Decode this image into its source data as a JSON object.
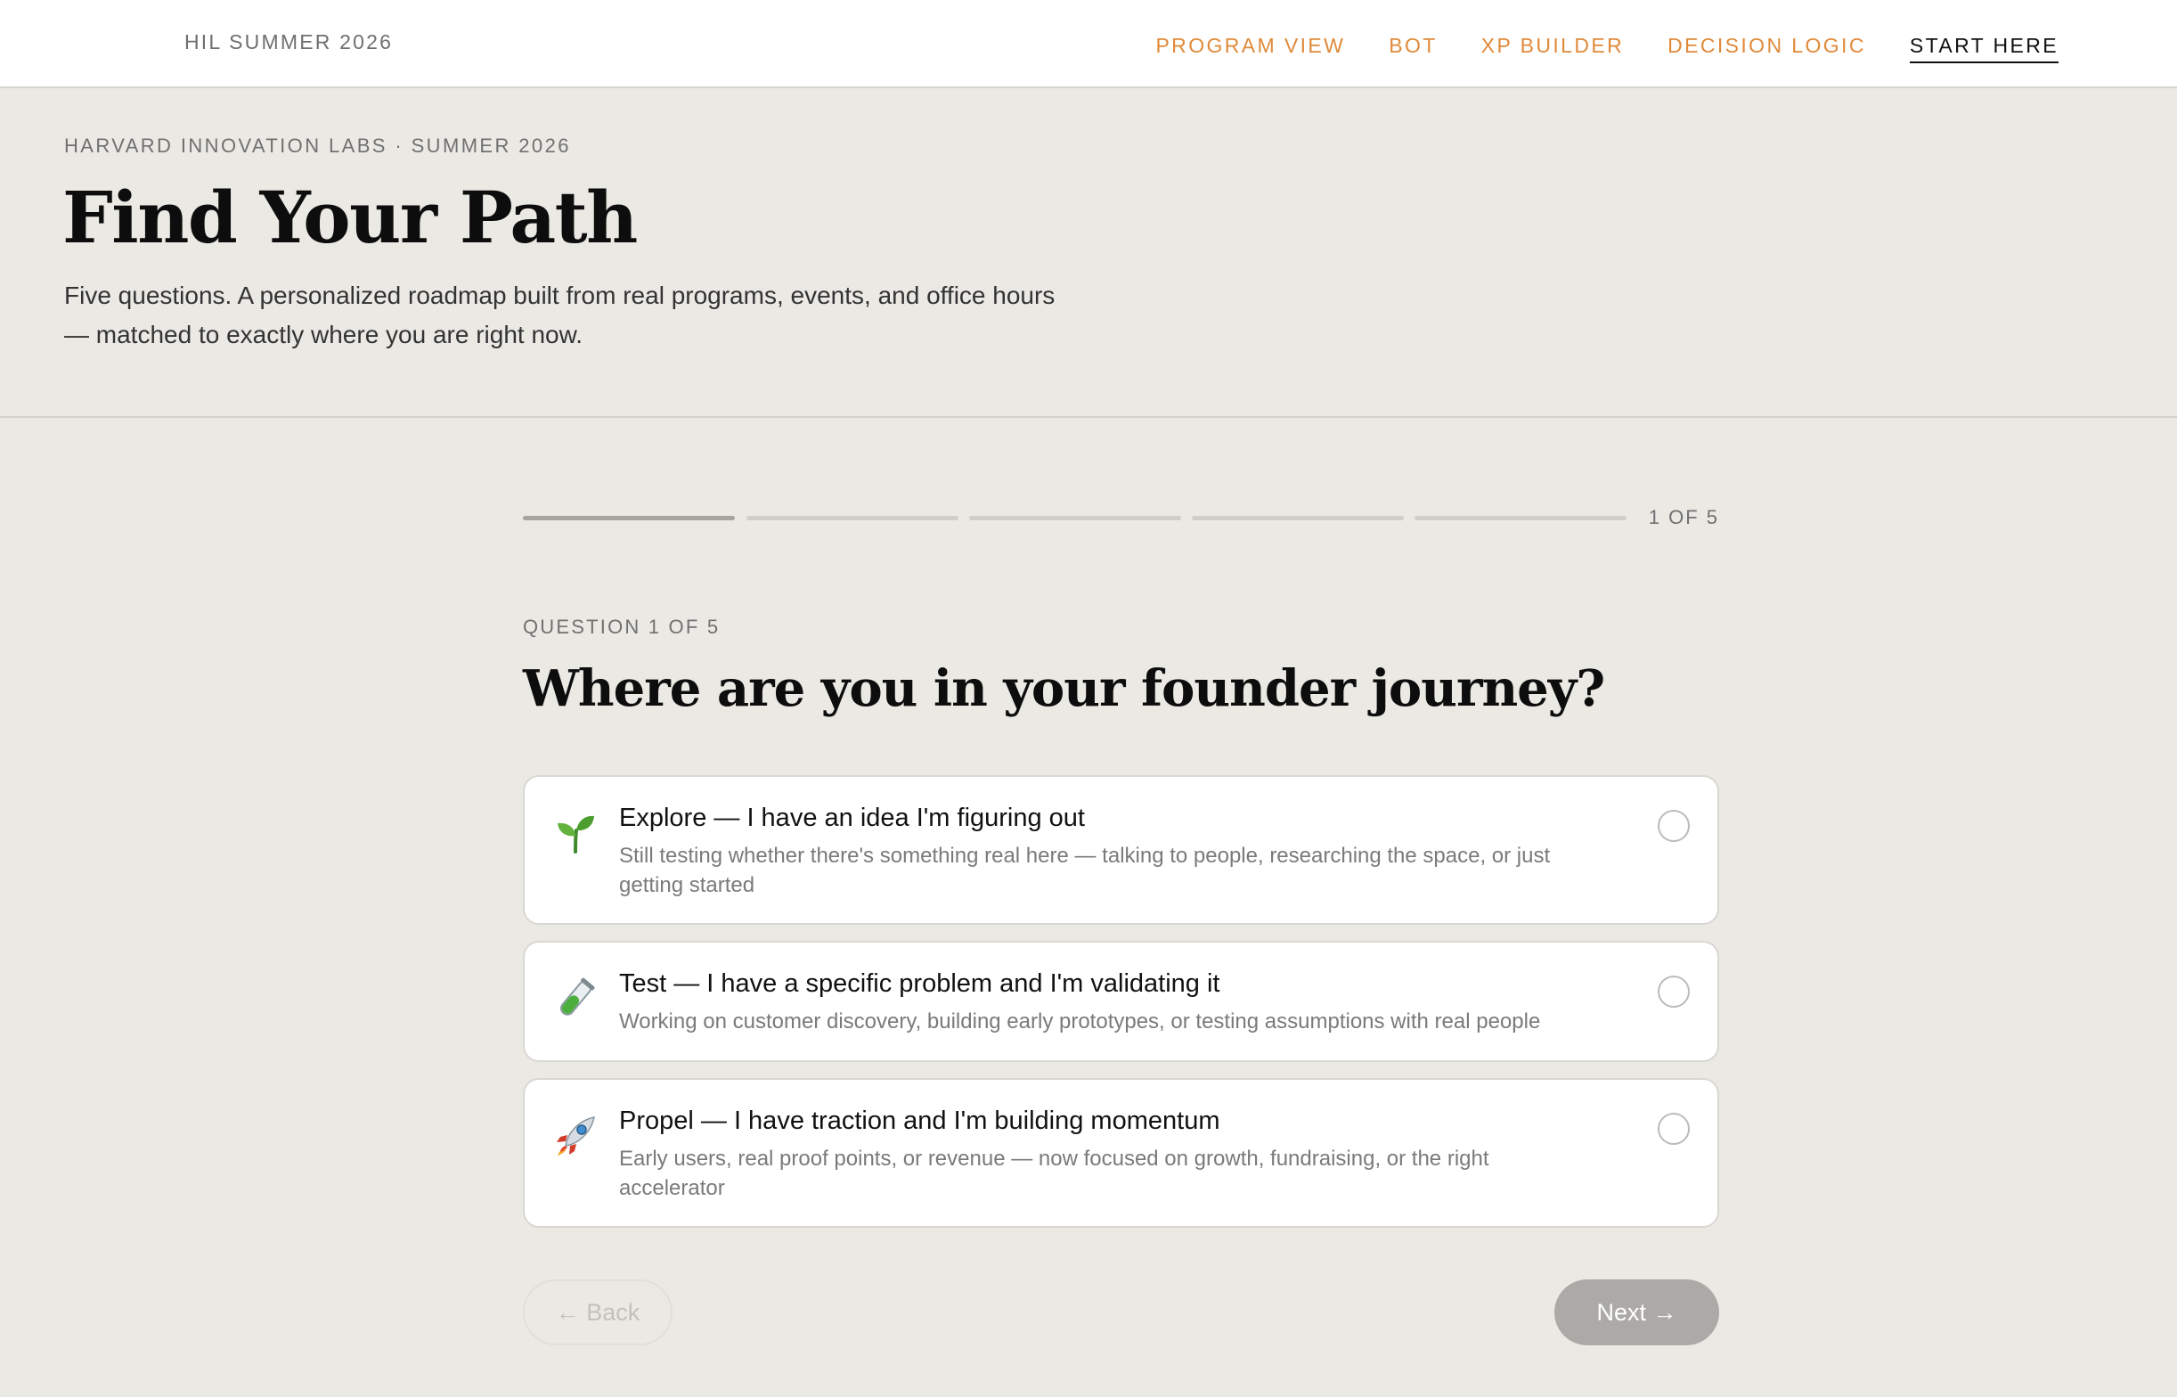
{
  "nav": {
    "brand": "HIL SUMMER 2026",
    "links": [
      {
        "label": "PROGRAM VIEW"
      },
      {
        "label": "BOT"
      },
      {
        "label": "XP BUILDER"
      },
      {
        "label": "DECISION LOGIC"
      },
      {
        "label": "START HERE",
        "active": true
      }
    ]
  },
  "hero": {
    "eyebrow": "HARVARD INNOVATION LABS · SUMMER 2026",
    "title": "Find Your Path",
    "subtitle": "Five questions. A personalized roadmap built from real programs, events, and office hours — matched to exactly where you are right now."
  },
  "quiz": {
    "progress_label": "1 OF 5",
    "progress": {
      "current": 1,
      "total": 5
    },
    "question_eyebrow": "QUESTION 1 OF 5",
    "question": "Where are you in your founder journey?",
    "options": [
      {
        "icon": "seedling-icon",
        "title": "Explore — I have an idea I'm figuring out",
        "description": "Still testing whether there's something real here — talking to people, researching the space, or just getting started",
        "selected": false
      },
      {
        "icon": "test-tube-icon",
        "title": "Test — I have a specific problem and I'm validating it",
        "description": "Working on customer discovery, building early prototypes, or testing assumptions with real people",
        "selected": false
      },
      {
        "icon": "rocket-icon",
        "title": "Propel — I have traction and I'm building momentum",
        "description": "Early users, real proof points, or revenue — now focused on growth, fundraising, or the right accelerator",
        "selected": false
      }
    ],
    "back_label": "← Back",
    "next_label": "Next →"
  },
  "colors": {
    "background": "#ebe9e4",
    "accent": "#e08a3a",
    "card": "#ffffff",
    "button_disabled": "#acaaa6"
  }
}
